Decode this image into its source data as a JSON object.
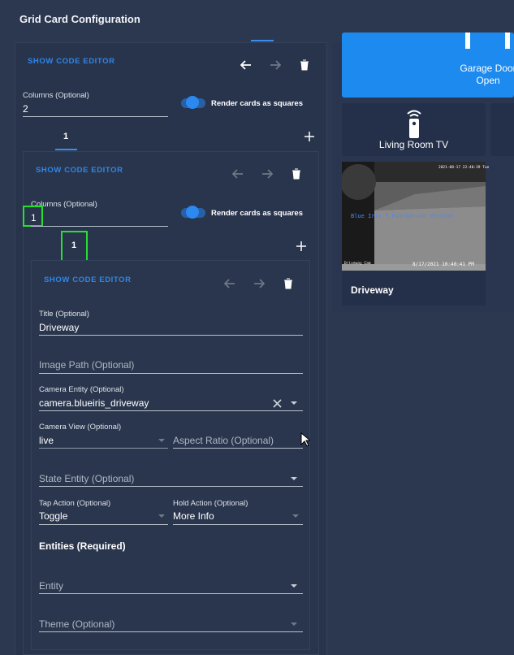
{
  "header": {
    "title": "Grid Card Configuration"
  },
  "colors": {
    "accent": "#2f86e8",
    "highlight": "#27e02e",
    "background": "#2c3850",
    "tile": "#243049",
    "garage_tile": "#1d8af0"
  },
  "outer": {
    "show_code_editor": "SHOW CODE EDITOR",
    "columns_label": "Columns (Optional)",
    "columns_value": "2",
    "toggle_label": "Render cards as squares",
    "tab_label": "1",
    "add_icon": "plus-icon"
  },
  "inner": {
    "show_code_editor": "SHOW CODE EDITOR",
    "columns_label": "Columns (Optional)",
    "columns_value": "1",
    "toggle_label": "Render cards as squares",
    "tab_label": "1",
    "add_icon": "plus-icon"
  },
  "picture_card": {
    "show_code_editor": "SHOW CODE EDITOR",
    "title_label": "Title (Optional)",
    "title_value": "Driveway",
    "image_path_placeholder": "Image Path (Optional)",
    "camera_entity_label": "Camera Entity (Optional)",
    "camera_entity_value": "camera.blueiris_driveway",
    "camera_view_label": "Camera View (Optional)",
    "camera_view_value": "live",
    "aspect_ratio_placeholder": "Aspect Ratio (Optional)",
    "state_entity_placeholder": "State Entity (Optional)",
    "tap_action_label": "Tap Action (Optional)",
    "tap_action_value": "Toggle",
    "hold_action_label": "Hold Action (Optional)",
    "hold_action_value": "More Info",
    "entities_heading": "Entities (Required)",
    "entity_placeholder": "Entity",
    "theme_placeholder": "Theme (Optional)"
  },
  "preview": {
    "garage_line1": "Garage Door",
    "garage_line2": "Open",
    "tv_name": "Living Room TV",
    "tv_icon": "remote-icon",
    "camera_name": "Driveway",
    "camera_timestamp": "2021-08-17 22:40:39 Tue",
    "camera_overlay": "Blue Iris 5 Evaluation Version",
    "camera_label": "Driveway Cam",
    "camera_bottom": "8/17/2021 10:40:41 PM"
  }
}
